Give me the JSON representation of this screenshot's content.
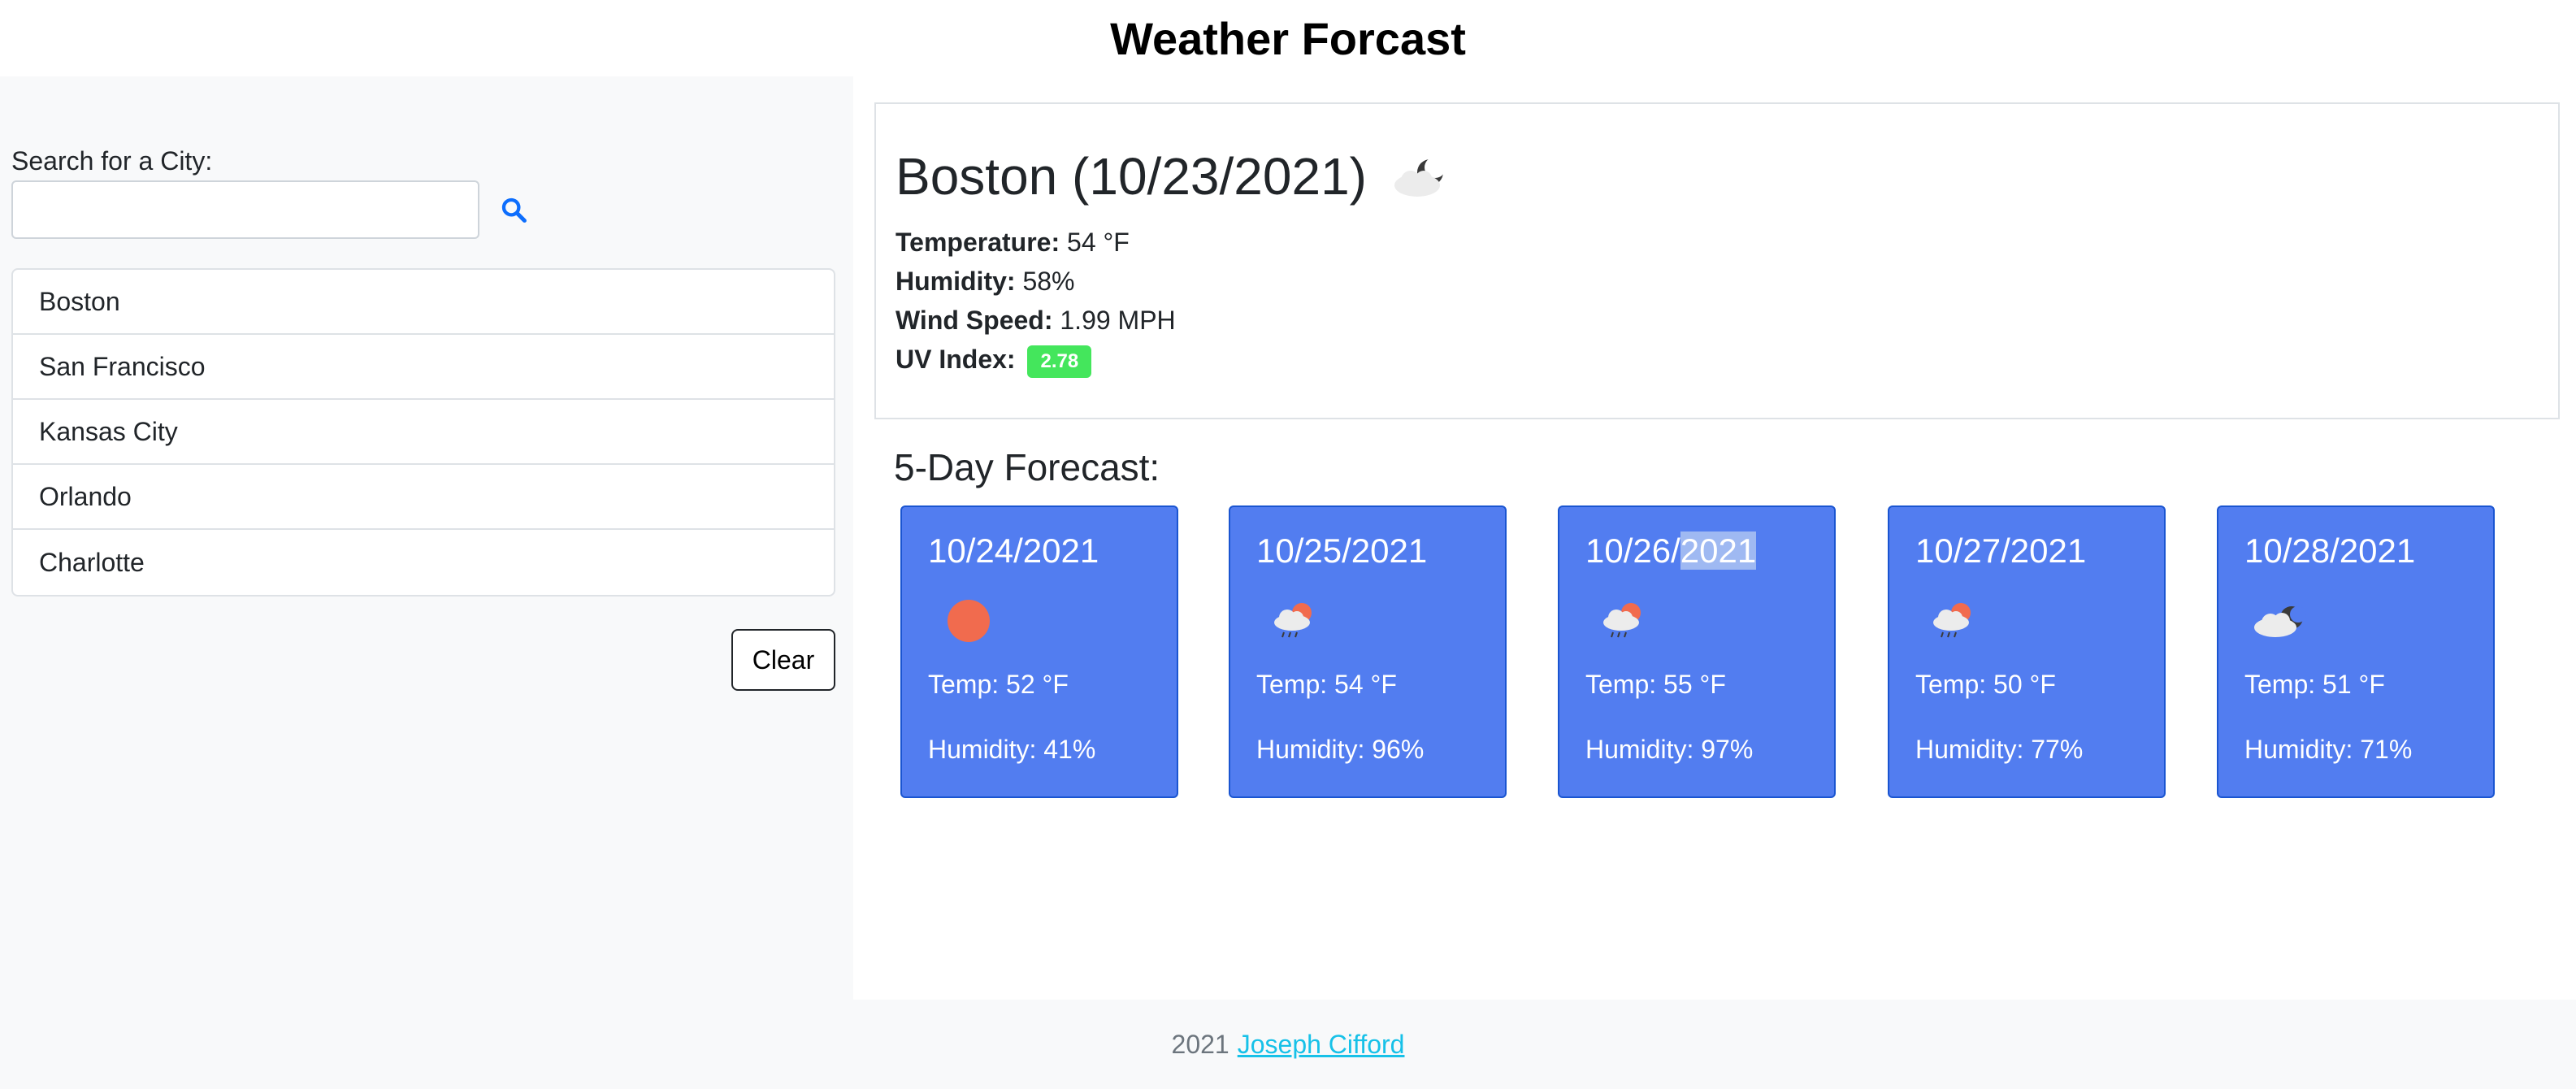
{
  "header": {
    "title": "Weather Forcast"
  },
  "search": {
    "label": "Search for a City:",
    "value": "",
    "placeholder": "",
    "button_icon": "search-icon"
  },
  "history": [
    "Boston",
    "San Francisco",
    "Kansas City",
    "Orlando",
    "Charlotte"
  ],
  "clear_label": "Clear",
  "current": {
    "heading": "Boston (10/23/2021)",
    "icon": "partly-cloudy-night-icon",
    "temperature_label": "Temperature:",
    "temperature": "54 °F",
    "humidity_label": "Humidity:",
    "humidity": "58%",
    "wind_label": "Wind Speed:",
    "wind": "1.99 MPH",
    "uv_label": "UV Index:",
    "uv": "2.78"
  },
  "forecast": {
    "title": "5-Day Forecast:",
    "days": [
      {
        "date": "10/24/2021",
        "icon": "sun-icon",
        "temp": "Temp: 52 °F",
        "humidity": "Humidity: 41%"
      },
      {
        "date": "10/25/2021",
        "icon": "rain-sun-icon",
        "temp": "Temp: 54 °F",
        "humidity": "Humidity: 96%"
      },
      {
        "date_part1": "10/26/",
        "date_part2": "2021",
        "icon": "rain-sun-icon",
        "temp": "Temp: 55 °F",
        "humidity": "Humidity: 97%"
      },
      {
        "date": "10/27/2021",
        "icon": "rain-sun-icon",
        "temp": "Temp: 50 °F",
        "humidity": "Humidity: 77%"
      },
      {
        "date": "10/28/2021",
        "icon": "cloudy-night-icon",
        "temp": "Temp: 51 °F",
        "humidity": "Humidity: 71%"
      }
    ]
  },
  "footer": {
    "year": "2021",
    "author": "Joseph Cifford"
  },
  "colors": {
    "card_bg": "#527df0",
    "card_border": "#1a55d1",
    "uv_badge": "#44e65c",
    "search_icon": "#0d6efd",
    "link": "#17c1e8",
    "sun": "#f16b4e"
  }
}
